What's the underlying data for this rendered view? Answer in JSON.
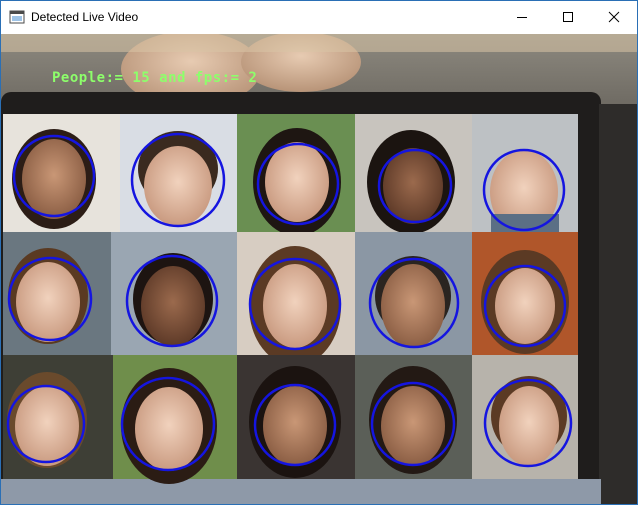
{
  "window": {
    "title": "Detected Live Video",
    "controls": [
      "minimize",
      "maximize",
      "close"
    ]
  },
  "video": {
    "overlay_text": "People:= 15 and fps:= 2",
    "overlay_color": "#8dff6b",
    "detection_color": "#1515e0",
    "detections_count": 15
  }
}
